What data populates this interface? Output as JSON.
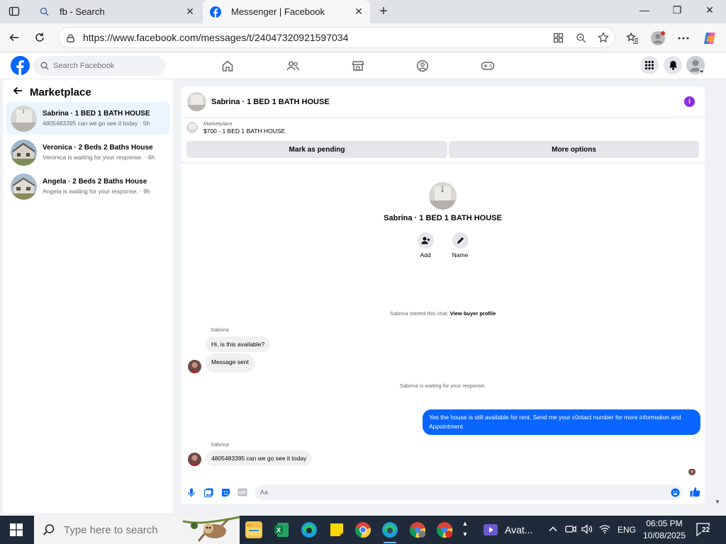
{
  "browser": {
    "tabs": [
      {
        "title": "fb - Search",
        "active": false
      },
      {
        "title": "Messenger | Facebook",
        "active": true
      }
    ],
    "url": "https://www.facebook.com/messages/t/24047320921597034"
  },
  "fb_header": {
    "search_placeholder": "Search Facebook"
  },
  "sidebar": {
    "title": "Marketplace",
    "conversations": [
      {
        "name": "Sabrina · 1 BED 1 BATH HOUSE",
        "preview": "4805483395 can we go see it today · 5h",
        "selected": true
      },
      {
        "name": "Veronica · 2 Beds 2 Baths House",
        "preview": "Veronica is waiting for your response. · 6h",
        "selected": false
      },
      {
        "name": "Angela · 2 Beds 2 Baths House",
        "preview": "Angela is waiting for your response. · 9h",
        "selected": false
      }
    ]
  },
  "chat": {
    "header_name": "Sabrina · 1 BED 1 BATH HOUSE",
    "listing": {
      "tag": "Marketplace",
      "price_title": "$700 - 1 BED 1 BATH HOUSE"
    },
    "buttons": {
      "mark_pending": "Mark as pending",
      "more_options": "More options"
    },
    "profile": {
      "name": "Sabrina · 1 BED 1 BATH HOUSE",
      "add_label": "Add",
      "name_label": "Name"
    },
    "started_text": "Sabrina started this chat.",
    "view_buyer_profile": "View buyer profile",
    "messages": {
      "sender1": "Sabrina",
      "msg1": "Hi, is this available?",
      "msg2": "Message sent",
      "waiting": "Sabrina is waiting for your response.",
      "outgoing": "Yes the house is still available for rent, Send me your c0ntact number for more information and Appointment",
      "sender2": "Sabrina",
      "msg3": "4805483395 can we go see it today"
    },
    "composer_placeholder": "Aa"
  },
  "taskbar": {
    "search_placeholder": "Type here to search",
    "pinned_app_label": "Avat...",
    "language": "ENG",
    "time": "06:05 PM",
    "date": "10/08/2025",
    "notification_count": "22"
  },
  "colors": {
    "fb_blue": "#0866ff",
    "selected_conv": "#ebf5ff",
    "info_purple": "#8a2be2",
    "taskbar": "#1f2b3a"
  }
}
